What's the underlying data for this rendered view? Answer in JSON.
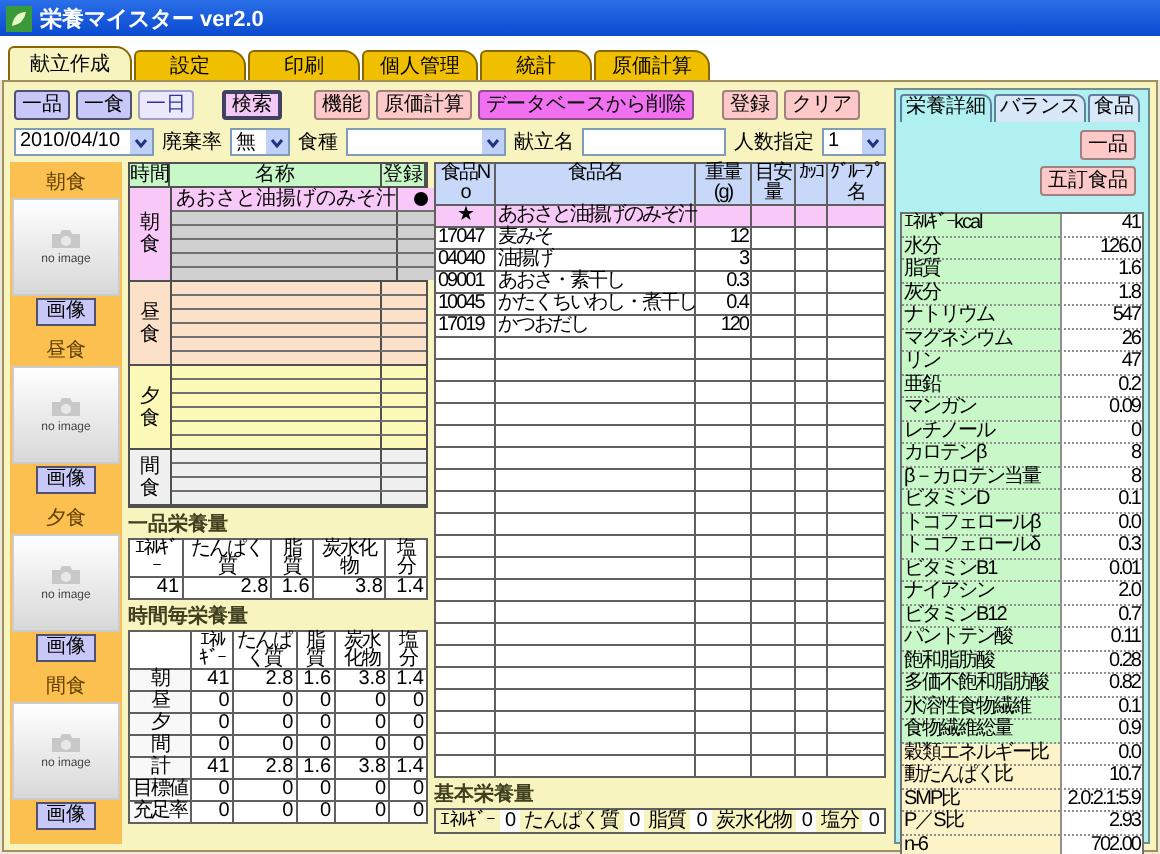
{
  "window": {
    "title": "栄養マイスター ver2.0"
  },
  "tabs": [
    {
      "label": "献立作成",
      "selected": true
    },
    {
      "label": "設定",
      "selected": false
    },
    {
      "label": "印刷",
      "selected": false
    },
    {
      "label": "個人管理",
      "selected": false
    },
    {
      "label": "統計",
      "selected": false
    },
    {
      "label": "原価計算",
      "selected": false
    }
  ],
  "toolbar": [
    {
      "label": "一品",
      "kind": "normal"
    },
    {
      "label": "一食",
      "kind": "normal"
    },
    {
      "label": "一日",
      "kind": "light"
    },
    {
      "label": "検索",
      "kind": "search"
    },
    {
      "label": "機能",
      "kind": "pink"
    },
    {
      "label": "原価計算",
      "kind": "pink"
    },
    {
      "label": "データベースから削除",
      "kind": "magenta"
    },
    {
      "label": "登録",
      "kind": "pink"
    },
    {
      "label": "クリア",
      "kind": "pink"
    }
  ],
  "filters": {
    "date": "2010/04/10",
    "waste_rate_label": "廃棄率",
    "waste_rate": "無",
    "diet_type_label": "食種",
    "menu_name_label": "献立名",
    "people_label": "人数指定",
    "people": "1"
  },
  "meal_photos": [
    {
      "label": "朝食",
      "placeholder": "no image",
      "button": "画像"
    },
    {
      "label": "昼食",
      "placeholder": "no image",
      "button": "画像"
    },
    {
      "label": "夕食",
      "placeholder": "no image",
      "button": "画像"
    },
    {
      "label": "間食",
      "placeholder": "no image",
      "button": "画像"
    }
  ],
  "menu_table": {
    "columns": [
      "時間",
      "名称",
      "登録"
    ],
    "groups": [
      {
        "label": "朝食",
        "color": "#f8c8f8",
        "rows": [
          {
            "name": "あおさと油揚げのみそ汁",
            "registered": true,
            "selected": true
          }
        ]
      },
      {
        "label": "昼食",
        "color": "#fce0c8"
      },
      {
        "label": "夕食",
        "color": "#fcf8b8"
      },
      {
        "label": "間食",
        "color": "#f0f0f0"
      }
    ]
  },
  "nutrition_single": {
    "title": "一品栄養量",
    "columns": [
      "ｴﾈﾙｷﾞｰ",
      "たんぱく質",
      "脂質",
      "炭水化物",
      "塩分"
    ],
    "values": [
      "41",
      "2.8",
      "1.6",
      "3.8",
      "1.4"
    ]
  },
  "nutrition_by_time": {
    "title": "時間毎栄養量",
    "columns": [
      "ｴﾈﾙｷﾞｰ",
      "たんぱく質",
      "脂質",
      "炭水化物",
      "塩分"
    ],
    "rows": [
      {
        "label": "朝",
        "values": [
          "41",
          "2.8",
          "1.6",
          "3.8",
          "1.4"
        ]
      },
      {
        "label": "昼",
        "values": [
          "0",
          "0",
          "0",
          "0",
          "0"
        ]
      },
      {
        "label": "夕",
        "values": [
          "0",
          "0",
          "0",
          "0",
          "0"
        ]
      },
      {
        "label": "間",
        "values": [
          "0",
          "0",
          "0",
          "0",
          "0"
        ]
      },
      {
        "label": "計",
        "values": [
          "41",
          "2.8",
          "1.6",
          "3.8",
          "1.4"
        ]
      },
      {
        "label": "目標値",
        "values": [
          "0",
          "0",
          "0",
          "0",
          "0"
        ]
      },
      {
        "label": "充足率",
        "values": [
          "0",
          "0",
          "0",
          "0",
          "0"
        ]
      }
    ]
  },
  "food_table": {
    "columns": [
      "食品No",
      "食品名",
      "重量(g)",
      "目安量",
      "ｶｯｺ",
      "ｸﾞﾙｰﾌﾟ名"
    ],
    "dish": {
      "mark": "★",
      "name": "あおさと油揚げのみそ汁"
    },
    "rows": [
      {
        "no": "17047",
        "name": "麦みそ",
        "weight": "12"
      },
      {
        "no": "04040",
        "name": "油揚げ",
        "weight": "3"
      },
      {
        "no": "09001",
        "name": "あおさ・素干し",
        "weight": "0.3"
      },
      {
        "no": "10045",
        "name": "かたくちいわし・煮干し",
        "weight": "0.4"
      },
      {
        "no": "17019",
        "name": "かつおだし",
        "weight": "120"
      }
    ]
  },
  "basic_nutrition": {
    "title": "基本栄養量",
    "items": [
      {
        "label": "ｴﾈﾙｷﾞｰ",
        "value": "0"
      },
      {
        "label": "たんぱく質",
        "value": "0"
      },
      {
        "label": "脂質",
        "value": "0"
      },
      {
        "label": "炭水化物",
        "value": "0"
      },
      {
        "label": "塩分",
        "value": "0"
      }
    ]
  },
  "side_panel": {
    "tabs": [
      {
        "label": "栄養詳細",
        "selected": true
      },
      {
        "label": "バランス",
        "selected": false
      },
      {
        "label": "食品",
        "selected": false
      }
    ],
    "buttons": [
      "一品",
      "五訂食品"
    ],
    "nutrients": [
      {
        "name": "ｴﾈﾙｷﾞｰkcal",
        "value": "41",
        "kind": "nutrient"
      },
      {
        "name": "水分",
        "value": "126.0",
        "kind": "nutrient"
      },
      {
        "name": "脂質",
        "value": "1.6",
        "kind": "nutrient"
      },
      {
        "name": "灰分",
        "value": "1.8",
        "kind": "nutrient"
      },
      {
        "name": "ナトリウム",
        "value": "547",
        "kind": "nutrient"
      },
      {
        "name": "マグネシウム",
        "value": "26",
        "kind": "nutrient"
      },
      {
        "name": "リン",
        "value": "47",
        "kind": "nutrient"
      },
      {
        "name": "亜鉛",
        "value": "0.2",
        "kind": "nutrient"
      },
      {
        "name": "マンガン",
        "value": "0.09",
        "kind": "nutrient"
      },
      {
        "name": "レチノール",
        "value": "0",
        "kind": "nutrient"
      },
      {
        "name": "カロテンβ",
        "value": "8",
        "kind": "nutrient"
      },
      {
        "name": "β－カロテン当量",
        "value": "8",
        "kind": "nutrient"
      },
      {
        "name": "ビタミンD",
        "value": "0.1",
        "kind": "nutrient"
      },
      {
        "name": "トコフェロールβ",
        "value": "0.0",
        "kind": "nutrient"
      },
      {
        "name": "トコフェロールδ",
        "value": "0.3",
        "kind": "nutrient"
      },
      {
        "name": "ビタミンB1",
        "value": "0.01",
        "kind": "nutrient"
      },
      {
        "name": "ナイアシン",
        "value": "2.0",
        "kind": "nutrient"
      },
      {
        "name": "ビタミンB12",
        "value": "0.7",
        "kind": "nutrient"
      },
      {
        "name": "パントテン酸",
        "value": "0.11",
        "kind": "nutrient"
      },
      {
        "name": "飽和脂肪酸",
        "value": "0.28",
        "kind": "nutrient"
      },
      {
        "name": "多価不飽和脂肪酸",
        "value": "0.82",
        "kind": "nutrient"
      },
      {
        "name": "水溶性食物繊維",
        "value": "0.1",
        "kind": "nutrient"
      },
      {
        "name": "食物繊維総量",
        "value": "0.9",
        "kind": "nutrient"
      },
      {
        "name": "穀類エネルギー比",
        "value": "0.0",
        "kind": "ratio"
      },
      {
        "name": "動たんぱく比",
        "value": "10.7",
        "kind": "ratio"
      },
      {
        "name": "SMP比",
        "value": "2.0:2.1:5.9",
        "kind": "ratio"
      },
      {
        "name": "P／S比",
        "value": "2.93",
        "kind": "ratio"
      },
      {
        "name": "n-6",
        "value": "702.00",
        "kind": "ratio"
      }
    ]
  }
}
